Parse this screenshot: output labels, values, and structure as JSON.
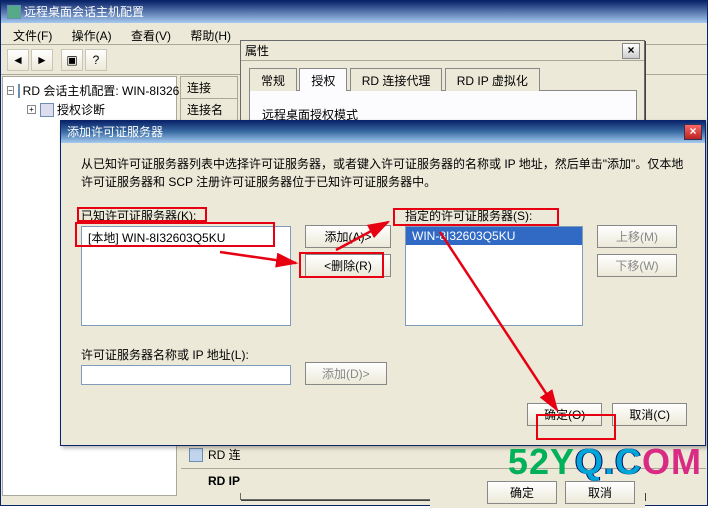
{
  "main": {
    "title": "远程桌面会话主机配置",
    "menu": {
      "file": "文件(F)",
      "action": "操作(A)",
      "view": "查看(V)",
      "help": "帮助(H)"
    },
    "tree": {
      "node1": "RD 会话主机配置: WIN-8I326",
      "node2": "授权诊断"
    },
    "conn": {
      "h1": "连接",
      "h2": "连接名"
    },
    "bottom": {
      "item1": "RD 连",
      "item2": "RD IP",
      "ok": "确定",
      "cancel": "取消"
    }
  },
  "prop": {
    "title": "属性",
    "tabs": {
      "general": "常规",
      "license": "授权",
      "broker": "RD 连接代理",
      "ip": "RD IP 虚拟化"
    },
    "body_label": "远程桌面授权模式"
  },
  "dialog": {
    "title": "添加许可证服务器",
    "desc": "从已知许可证服务器列表中选择许可证服务器，或者键入许可证服务器的名称或 IP 地址，然后单击\"添加\"。仅本地许可证服务器和 SCP 注册许可证服务器位于已知许可证服务器中。",
    "known_label": "已知许可证服务器(K):",
    "known_item": "[本地]  WIN-8I32603Q5KU",
    "spec_label": "指定的许可证服务器(S):",
    "spec_item": "WIN-8I32603Q5KU",
    "add": "添加(A)>",
    "del": "<删除(R)",
    "up": "上移(M)",
    "down": "下移(W)",
    "name_label": "许可证服务器名称或 IP 地址(L):",
    "add2": "添加(D)>",
    "ok": "确定(O)",
    "cancel": "取消(C)"
  },
  "watermark": {
    "a": "52Y",
    "b": "Q.C",
    "c": "OM"
  }
}
